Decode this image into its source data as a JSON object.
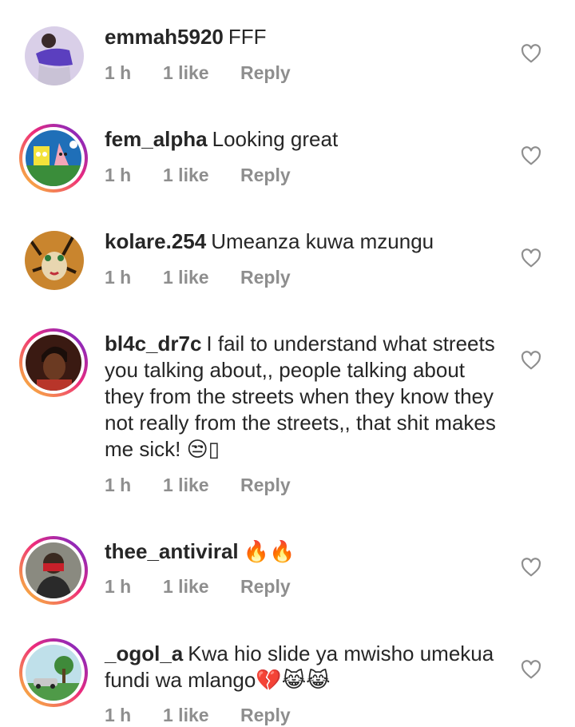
{
  "comments": [
    {
      "username": "emmah5920",
      "text": "FFF",
      "time": "1 h",
      "likes": "1 like",
      "reply": "Reply"
    },
    {
      "username": "fem_alpha",
      "text": "Looking great",
      "time": "1 h",
      "likes": "1 like",
      "reply": "Reply"
    },
    {
      "username": "kolare.254",
      "text": "Umeanza kuwa mzungu",
      "time": "1 h",
      "likes": "1 like",
      "reply": "Reply"
    },
    {
      "username": "bl4c_dr7c",
      "text": "I fail to understand what streets you talking about,, people talking about they from the streets when they know they not really from the streets,, that shit makes me sick! 😒▯",
      "time": "1 h",
      "likes": "1 like",
      "reply": "Reply"
    },
    {
      "username": "thee_antiviral",
      "text": "🔥🔥",
      "time": "1 h",
      "likes": "1 like",
      "reply": "Reply"
    },
    {
      "username": "_ogol_a",
      "text": "Kwa hio slide ya mwisho umekua fundi wa mlango💔😹😹",
      "time": "1 h",
      "likes": "1 like",
      "reply": "Reply"
    }
  ],
  "colors": {
    "text": "#262626",
    "muted": "#8e8e8e",
    "story_ring": [
      "#f9ce34",
      "#ee2a7b",
      "#6228d7"
    ]
  },
  "icons": {
    "like": "heart-outline-icon",
    "emoji_fire": "fire-emoji-icon",
    "emoji_unamused": "unamused-face-emoji",
    "emoji_broken_heart": "broken-heart-emoji",
    "emoji_cat": "grinning-cat-emoji"
  }
}
